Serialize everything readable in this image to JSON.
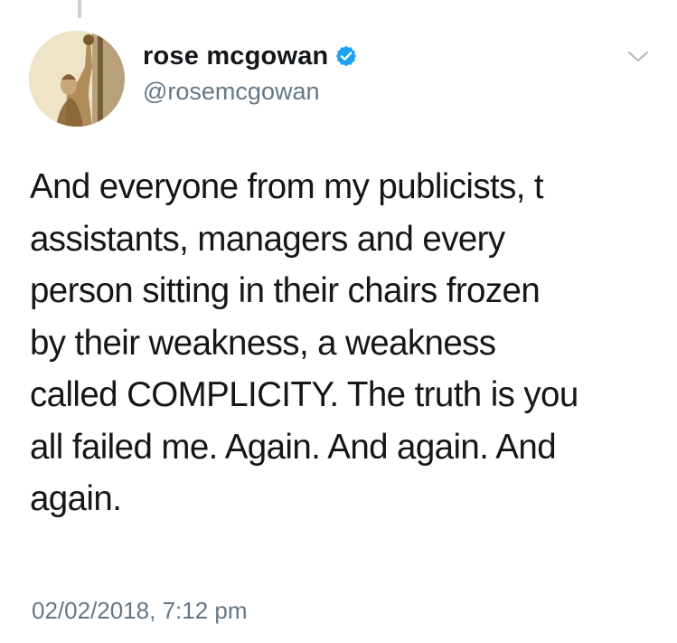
{
  "tweet": {
    "author": {
      "display_name": "rose mcgowan",
      "handle": "@rosemcgowan",
      "verified": true,
      "verified_icon": "verified-badge-icon",
      "avatar_icon": "profile-avatar"
    },
    "menu_icon": "chevron-down-icon",
    "text_lines": [
      "And everyone from my publicists, t",
      "assistants, managers and every",
      "person sitting in their chairs frozen",
      "by their weakness, a weakness",
      "called COMPLICITY. The truth is you",
      "all failed me. Again. And again. And",
      "again."
    ],
    "timestamp": "02/02/2018, 7:12 pm"
  },
  "colors": {
    "text": "#14171a",
    "secondary": "#657786",
    "verified_blue": "#1da1f2",
    "thread_line": "#c7d0d6"
  }
}
